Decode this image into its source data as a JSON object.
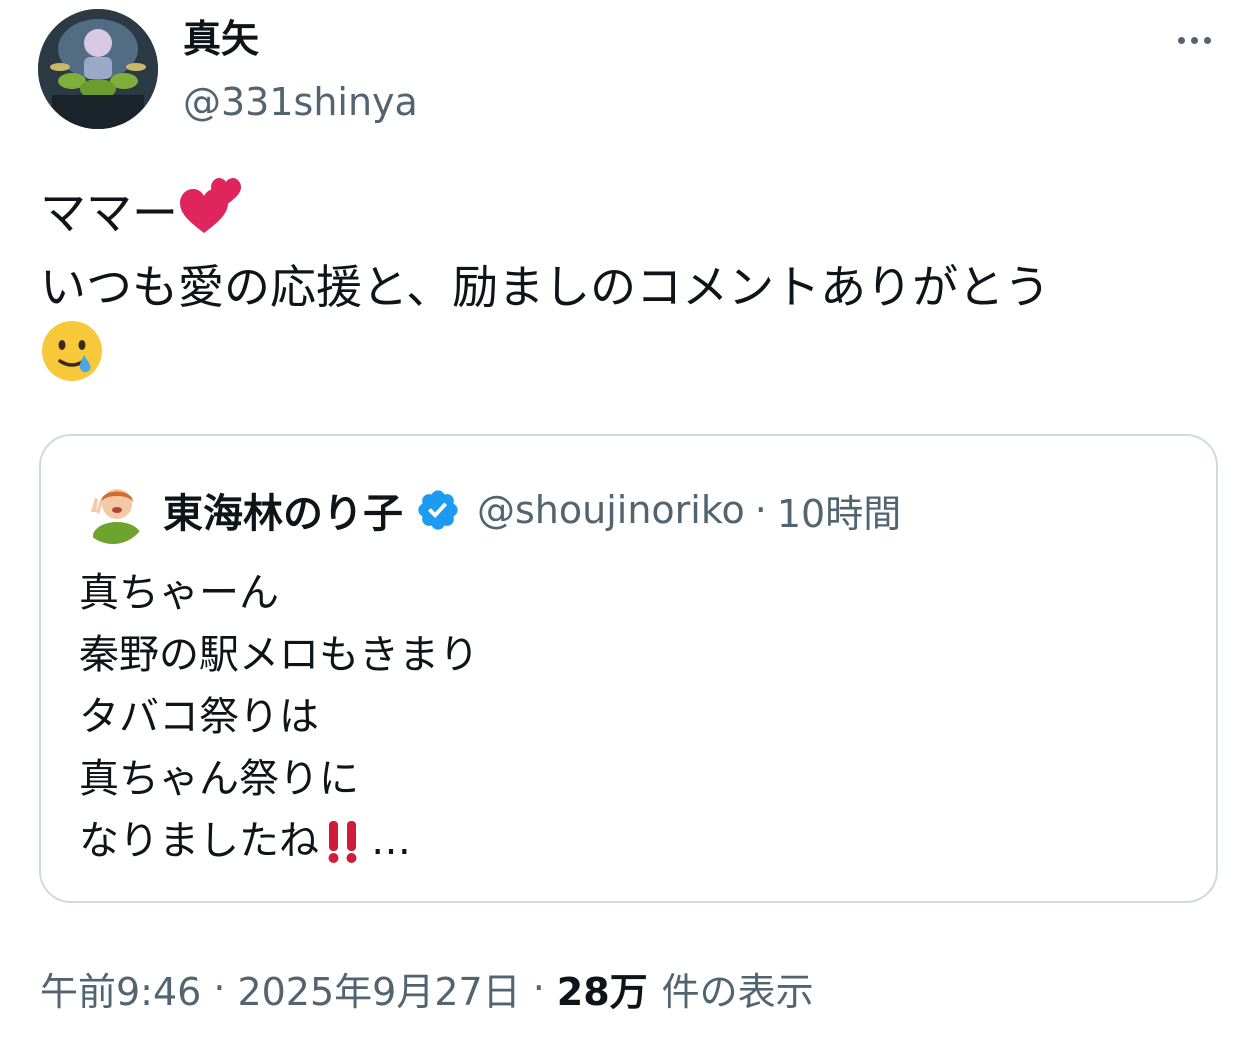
{
  "author": {
    "display_name": "真矢",
    "handle": "@331shinya"
  },
  "tweet": {
    "line1": "ママー",
    "line2": "いつも愛の応援と、励ましのコメントありがとう",
    "emoji_line1": "two-hearts-icon",
    "emoji_line3": "face-holding-back-tears-icon"
  },
  "quote": {
    "display_name": "東海林のり子",
    "handle": "@shoujinoriko",
    "separator": "·",
    "time": "10時間",
    "verified_color": "#1d9bf0",
    "lines": [
      "真ちゃーん",
      "秦野の駅メロもきまり",
      "タバコ祭りは",
      "真ちゃん祭りに",
      "なりましたね"
    ],
    "trailing_ellipsis": "…"
  },
  "meta": {
    "time": "午前9:46",
    "separator": "·",
    "date": "2025年9月27日",
    "views_count": "28万",
    "views_label": "件の表示"
  },
  "colors": {
    "text": "#0f1419",
    "secondary": "#536471",
    "border": "#cfd9de",
    "heart": "#e0245e",
    "bangbang": "#d01c3a"
  }
}
